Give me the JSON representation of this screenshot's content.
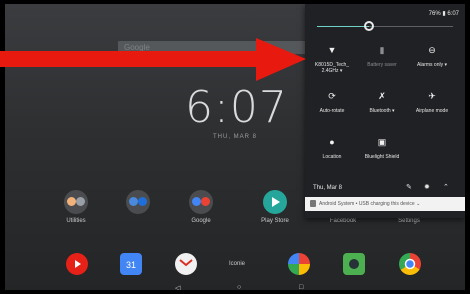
{
  "status_bar": {
    "battery_time": "76% ▮ 6:07"
  },
  "brightness": {
    "level": 0.38
  },
  "search": {
    "placeholder": "Google"
  },
  "clock": {
    "time": "6:07",
    "date": "THU, MAR 8"
  },
  "apps": [
    {
      "label": "Utilities",
      "icon": "folder-icon"
    },
    {
      "label": "",
      "icon": "folder-icon"
    },
    {
      "label": "Google",
      "icon": "folder-icon"
    },
    {
      "label": "Play Store",
      "icon": "play-store-icon"
    },
    {
      "label": "Facebook",
      "icon": "facebook-icon"
    },
    {
      "label": "Settings",
      "icon": "settings-icon"
    }
  ],
  "dock": {
    "center_label": "Iconie",
    "icons": [
      "youtube-icon",
      "calendar-icon",
      "gmail-icon",
      "photos-icon",
      "camera-icon",
      "chrome-icon"
    ]
  },
  "quick_settings": [
    {
      "label": "K8015D_Tech_ 2.4GHz",
      "icon": "wifi-icon",
      "active": true,
      "dropdown": true
    },
    {
      "label": "Battery saver",
      "icon": "battery-icon",
      "active": false
    },
    {
      "label": "Alarms only",
      "icon": "do-not-disturb-icon",
      "active": true,
      "dropdown": true
    },
    {
      "label": "Auto-rotate",
      "icon": "auto-rotate-icon",
      "active": true
    },
    {
      "label": "Bluetooth",
      "icon": "bluetooth-off-icon",
      "active": true,
      "dropdown": true
    },
    {
      "label": "Airplane mode",
      "icon": "airplane-icon",
      "active": true
    },
    {
      "label": "Location",
      "icon": "location-icon",
      "active": true
    },
    {
      "label": "Bluelight Shield",
      "icon": "bluelight-shield-icon",
      "active": true
    }
  ],
  "shade_footer": {
    "date": "Thu, Mar 8"
  },
  "notification": {
    "text": "Android System • USB charging this device ⌄"
  },
  "colors": {
    "accent": "#6fd3c7",
    "arrow": "#e8190f"
  }
}
